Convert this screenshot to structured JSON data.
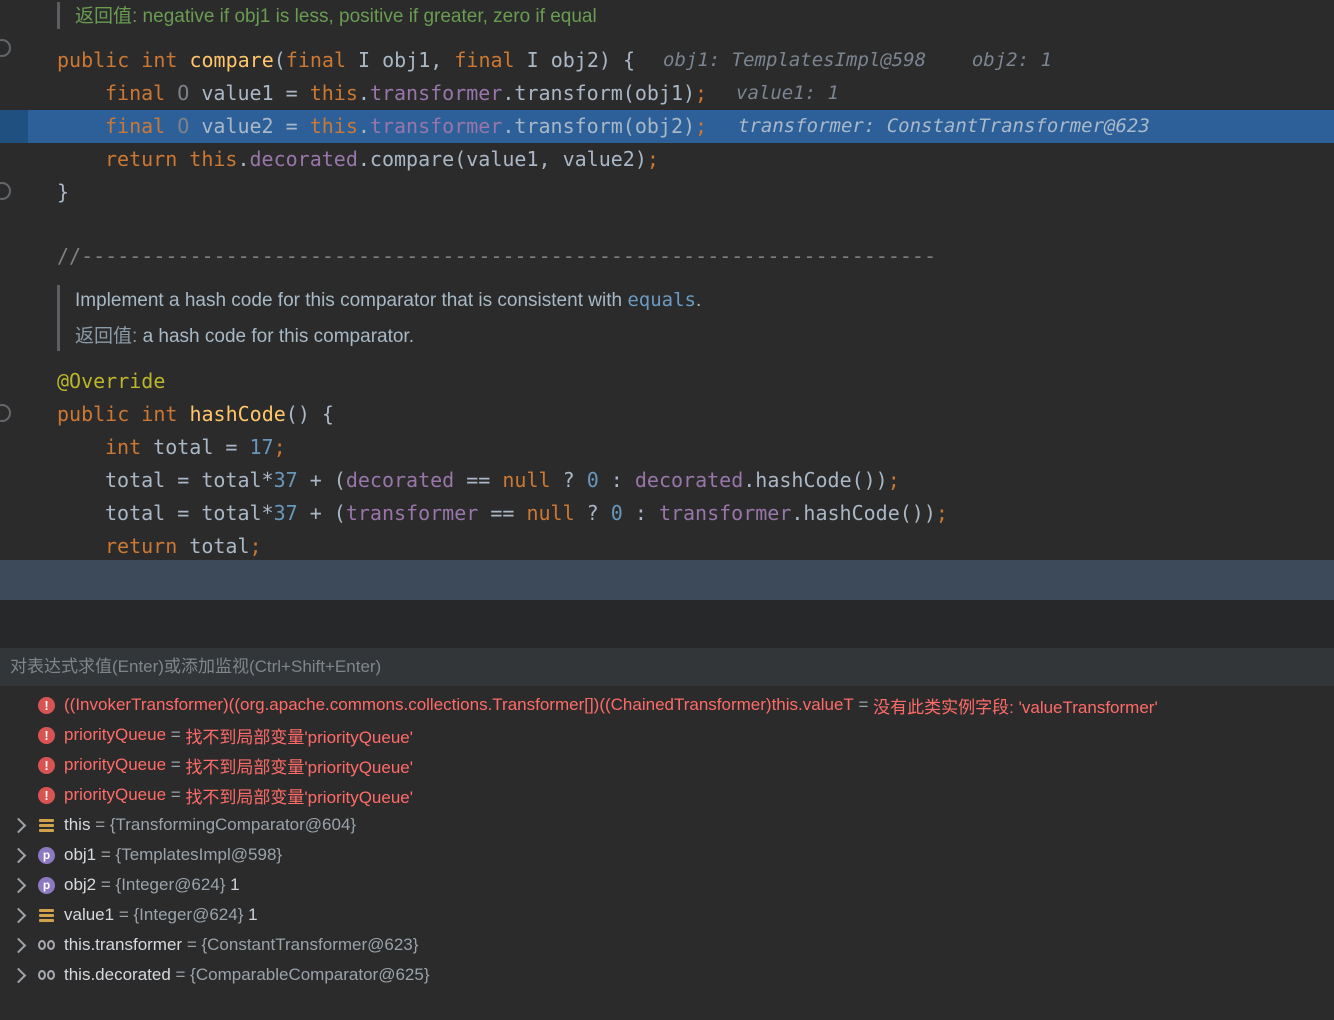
{
  "theme": {
    "editor_background": "#2b2b2b",
    "execution_line_highlight": "#2d6099",
    "error_color": "#ff6b68",
    "keyword_color": "#cc7832",
    "field_color": "#9876aa"
  },
  "editor": {
    "lines": [
      [
        {
          "c": "dg",
          "t": "返回值: negative if obj1 is less, positive if greater, zero if equal"
        }
      ],
      [
        {
          "c": "kw",
          "t": "public int "
        },
        {
          "c": "mn",
          "t": "compare"
        },
        {
          "c": "pl",
          "t": "("
        },
        {
          "c": "kw",
          "t": "final "
        },
        {
          "c": "pl",
          "t": "I obj1, "
        },
        {
          "c": "kw",
          "t": "final "
        },
        {
          "c": "pl",
          "t": "I obj2) {"
        }
      ],
      [
        {
          "c": "kw",
          "t": "final "
        },
        {
          "c": "ty",
          "t": "O "
        },
        {
          "c": "pl",
          "t": "value1 = "
        },
        {
          "c": "kw",
          "t": "this"
        },
        {
          "c": "pl",
          "t": "."
        },
        {
          "c": "fd",
          "t": "transformer"
        },
        {
          "c": "pl",
          "t": ".transform(obj1)"
        },
        {
          "c": "kw",
          "t": ";"
        }
      ],
      [
        {
          "c": "kw",
          "t": "final "
        },
        {
          "c": "ty",
          "t": "O "
        },
        {
          "c": "pl",
          "t": "value2 = "
        },
        {
          "c": "kw",
          "t": "this"
        },
        {
          "c": "pl",
          "t": "."
        },
        {
          "c": "fd",
          "t": "transformer"
        },
        {
          "c": "pl",
          "t": ".transform(obj2)"
        },
        {
          "c": "kw",
          "t": ";"
        }
      ],
      [
        {
          "c": "kw",
          "t": "return this"
        },
        {
          "c": "pl",
          "t": "."
        },
        {
          "c": "fd",
          "t": "decorated"
        },
        {
          "c": "pl",
          "t": ".compare(value1, value2)"
        },
        {
          "c": "kw",
          "t": ";"
        }
      ],
      [
        {
          "c": "pl",
          "t": "}"
        }
      ],
      [
        {
          "c": "cm",
          "t": "//-----------------------------------------------------------------------"
        }
      ],
      [
        {
          "c": "dt",
          "t": "Implement a hash code for this comparator that is consistent with "
        },
        {
          "c": "dc",
          "t": "equals"
        },
        {
          "c": "dt",
          "t": "."
        }
      ],
      [
        {
          "c": "dl",
          "t": "返回值: "
        },
        {
          "c": "dt",
          "t": "a hash code for this comparator."
        }
      ],
      [
        {
          "c": "an",
          "t": "@Override"
        }
      ],
      [
        {
          "c": "kw",
          "t": "public int "
        },
        {
          "c": "mn",
          "t": "hashCode"
        },
        {
          "c": "pl",
          "t": "() {"
        }
      ],
      [
        {
          "c": "kw",
          "t": "int "
        },
        {
          "c": "pl",
          "t": "total = "
        },
        {
          "c": "nm",
          "t": "17"
        },
        {
          "c": "kw",
          "t": ";"
        }
      ],
      [
        {
          "c": "pl",
          "t": "total = total*"
        },
        {
          "c": "nm",
          "t": "37"
        },
        {
          "c": "pl",
          "t": " + ("
        },
        {
          "c": "fd",
          "t": "decorated"
        },
        {
          "c": "pl",
          "t": " == "
        },
        {
          "c": "kw",
          "t": "null"
        },
        {
          "c": "pl",
          "t": " ? "
        },
        {
          "c": "nm",
          "t": "0"
        },
        {
          "c": "pl",
          "t": " : "
        },
        {
          "c": "fd",
          "t": "decorated"
        },
        {
          "c": "pl",
          "t": ".hashCode())"
        },
        {
          "c": "kw",
          "t": ";"
        }
      ],
      [
        {
          "c": "pl",
          "t": "total = total*"
        },
        {
          "c": "nm",
          "t": "37"
        },
        {
          "c": "pl",
          "t": " + ("
        },
        {
          "c": "fd",
          "t": "transformer"
        },
        {
          "c": "pl",
          "t": " == "
        },
        {
          "c": "kw",
          "t": "null"
        },
        {
          "c": "pl",
          "t": " ? "
        },
        {
          "c": "nm",
          "t": "0"
        },
        {
          "c": "pl",
          "t": " : "
        },
        {
          "c": "fd",
          "t": "transformer"
        },
        {
          "c": "pl",
          "t": ".hashCode())"
        },
        {
          "c": "kw",
          "t": ";"
        }
      ],
      [
        {
          "c": "kw",
          "t": "return "
        },
        {
          "c": "pl",
          "t": "total"
        },
        {
          "c": "kw",
          "t": ";"
        }
      ]
    ],
    "hints": [
      {
        "text": "obj1: TemplatesImpl@598    obj2: 1"
      },
      {
        "text": "value1: 1"
      },
      {
        "text": "transformer: ConstantTransformer@623"
      }
    ]
  },
  "debugger": {
    "evaluate_placeholder": "对表达式求值(Enter)或添加监视(Ctrl+Shift+Enter)",
    "rows": [
      {
        "icon": "error",
        "error": true,
        "name": "((InvokerTransformer)((org.apache.commons.collections.Transformer[])((ChainedTransformer)this.valueT",
        "value": "没有此类实例字段: 'valueTransformer'"
      },
      {
        "icon": "error",
        "error": true,
        "name": "priorityQueue",
        "value": "找不到局部变量'priorityQueue'"
      },
      {
        "icon": "error",
        "error": true,
        "name": "priorityQueue",
        "value": "找不到局部变量'priorityQueue'"
      },
      {
        "icon": "error",
        "error": true,
        "name": "priorityQueue",
        "value": "找不到局部变量'priorityQueue'"
      },
      {
        "icon": "value",
        "chevron": true,
        "name": "this",
        "value": "{TransformingComparator@604}"
      },
      {
        "icon": "param",
        "chevron": true,
        "name": "obj1",
        "value": "{TemplatesImpl@598}"
      },
      {
        "icon": "param",
        "chevron": true,
        "name": "obj2",
        "value": "{Integer@624}",
        "extra": "1"
      },
      {
        "icon": "value",
        "chevron": true,
        "name": "value1",
        "value": "{Integer@624}",
        "extra": "1"
      },
      {
        "icon": "watch",
        "chevron": true,
        "name": "this.transformer",
        "value": "{ConstantTransformer@623}"
      },
      {
        "icon": "watch",
        "chevron": true,
        "name": "this.decorated",
        "value": "{ComparableComparator@625}"
      }
    ]
  }
}
